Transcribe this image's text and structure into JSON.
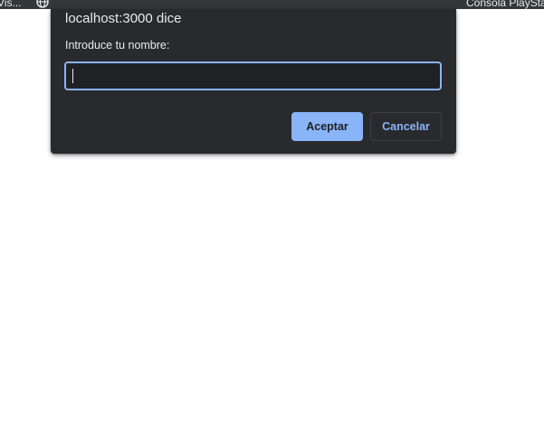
{
  "bookmarks_bar": {
    "left_item": "Vis...",
    "right_item": "Consola PlayStati",
    "icon": "globe-icon"
  },
  "dialog": {
    "title": "localhost:3000 dice",
    "message": "Introduce tu nombre:",
    "input": {
      "value": "",
      "placeholder": ""
    },
    "ok_label": "Aceptar",
    "cancel_label": "Cancelar"
  },
  "colors": {
    "dialog_bg": "#292a2d",
    "accent": "#8ab4f8",
    "input_bg": "#202124",
    "text": "#e8eaed"
  }
}
